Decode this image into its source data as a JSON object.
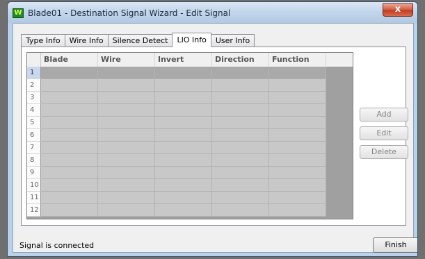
{
  "window": {
    "title": "Blade01 - Destination Signal Wizard - Edit Signal",
    "icon": "wizard-app-icon",
    "close_label": "x"
  },
  "tabs": [
    {
      "label": "Type Info",
      "active": false
    },
    {
      "label": "Wire Info",
      "active": false
    },
    {
      "label": "Silence Detect",
      "active": false
    },
    {
      "label": "LIO Info",
      "active": true
    },
    {
      "label": "User Info",
      "active": false
    }
  ],
  "grid": {
    "columns": [
      "Blade",
      "Wire",
      "Invert",
      "Direction",
      "Function"
    ],
    "rows": [
      "1",
      "2",
      "3",
      "4",
      "5",
      "6",
      "7",
      "8",
      "9",
      "10",
      "11",
      "12"
    ],
    "selected_row": "1"
  },
  "buttons": {
    "add": "Add",
    "edit": "Edit",
    "delete": "Delete",
    "finish": "Finish"
  },
  "status": {
    "text": "Signal is connected"
  },
  "colors": {
    "grid_cell": "#c8c8c8",
    "grid_selected": "#a9a9a9",
    "window_frame": "#b9d1ea"
  }
}
